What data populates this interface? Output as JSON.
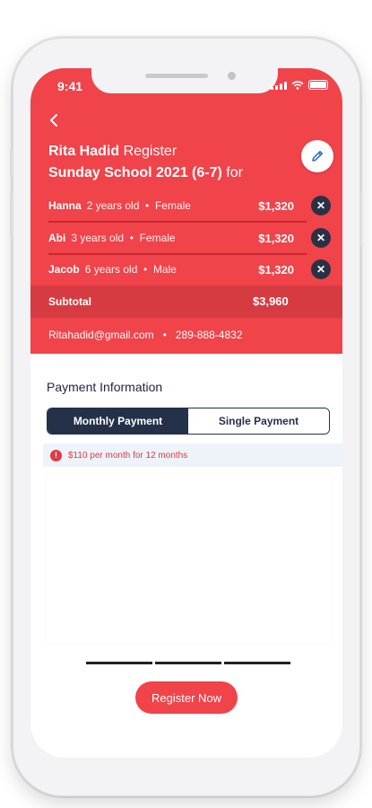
{
  "status": {
    "time": "9:41"
  },
  "header": {
    "parent_name": "Rita Hadid",
    "register_word": "Register",
    "program": "Sunday School 2021 (6-7)",
    "for_word": "for"
  },
  "children": [
    {
      "name": "Hanna",
      "age": "2 years old",
      "gender": "Female",
      "price": "$1,320"
    },
    {
      "name": "Abi",
      "age": "3 years old",
      "gender": "Female",
      "price": "$1,320"
    },
    {
      "name": "Jacob",
      "age": "6 years old",
      "gender": "Male",
      "price": "$1,320"
    }
  ],
  "subtotal": {
    "label": "Subtotal",
    "value": "$3,960"
  },
  "contact": {
    "email": "Ritahadid@gmail.com",
    "separator": "•",
    "phone": "289-888-4832"
  },
  "payment": {
    "title": "Payment Information",
    "options": [
      "Monthly Payment",
      "Single Payment"
    ],
    "selected": "Monthly Payment",
    "info_text": "$110 per month for 12 months"
  },
  "register_button": "Register Now",
  "colors": {
    "brand_red": "#f0434a",
    "navy": "#243149",
    "info_bg": "#eef3fa"
  }
}
